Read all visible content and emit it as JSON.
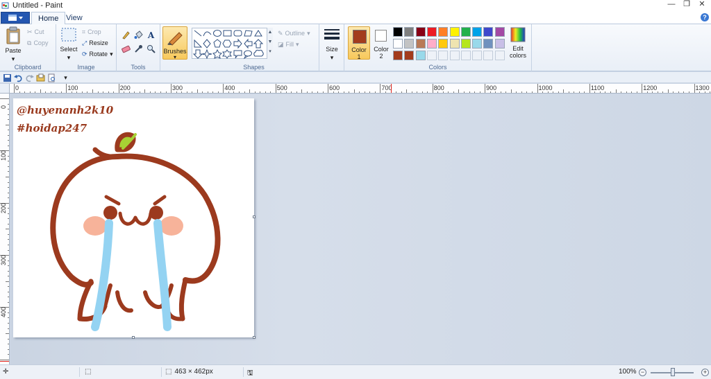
{
  "window": {
    "title": "Untitled - Paint",
    "buttons": {
      "minimize": "—",
      "restore": "❐",
      "close": "✕"
    }
  },
  "tabs": {
    "home": "Home",
    "view": "View",
    "help": "?"
  },
  "ribbon": {
    "clipboard": {
      "paste": "Paste",
      "cut": "Cut",
      "copy": "Copy",
      "label": "Clipboard"
    },
    "image": {
      "select": "Select",
      "crop": "Crop",
      "resize": "Resize",
      "rotate": "Rotate",
      "label": "Image"
    },
    "tools": {
      "label": "Tools"
    },
    "brushes": {
      "label": "Brushes"
    },
    "shapes": {
      "outline": "Outline",
      "fill": "Fill",
      "label": "Shapes"
    },
    "size": {
      "label": "Size"
    },
    "colors": {
      "color1_line1": "Color",
      "color1_line2": "1",
      "color2_line1": "Color",
      "color2_line2": "2",
      "edit_line1": "Edit",
      "edit_line2": "colors",
      "label": "Colors",
      "color1": "#a33c1d",
      "color2": "#ffffff",
      "palette_row1": [
        "#000000",
        "#7f7f7f",
        "#880015",
        "#ed1c24",
        "#ff7f27",
        "#fff200",
        "#22b14c",
        "#00a2e8",
        "#3f48cc",
        "#a349a4"
      ],
      "palette_row2": [
        "#ffffff",
        "#c3c3c3",
        "#b97a57",
        "#ffaec9",
        "#ffc90e",
        "#efe4b0",
        "#b5e61d",
        "#99d9ea",
        "#7092be",
        "#c8bfe7"
      ],
      "palette_row3": [
        "#a33c1d",
        "#a33c1d",
        "#99d9ea",
        "",
        "",
        "",
        "",
        "",
        "",
        ""
      ]
    }
  },
  "ruler": {
    "h_labels": [
      "0",
      "100",
      "200",
      "300",
      "400",
      "500",
      "600",
      "700",
      "800",
      "900",
      "1000",
      "1100",
      "1200",
      "1300"
    ],
    "v_labels": [
      "0",
      "100",
      "200",
      "300",
      "400"
    ]
  },
  "canvas": {
    "text_line1": "@huyenanh2k10",
    "text_line2": "#hoidap247"
  },
  "statusbar": {
    "size": "463 × 462px",
    "zoom": "100%",
    "zoom_out": "−",
    "zoom_in": "+"
  }
}
